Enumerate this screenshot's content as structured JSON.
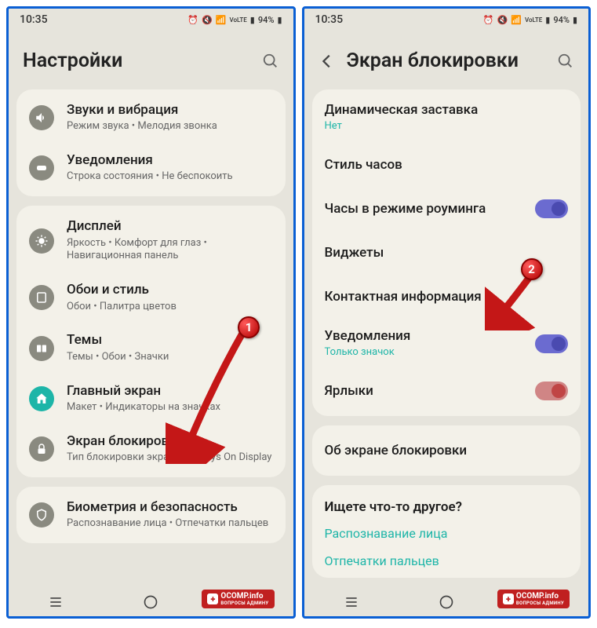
{
  "status": {
    "time": "10:35",
    "battery": "94%"
  },
  "left": {
    "title": "Настройки",
    "groups": [
      [
        {
          "title": "Звуки и вибрация",
          "sub": "Режим звука • Мелодия звонка",
          "icon": "speaker"
        },
        {
          "title": "Уведомления",
          "sub": "Строка состояния • Не беспокоить",
          "icon": "notify"
        }
      ],
      [
        {
          "title": "Дисплей",
          "sub": "Яркость • Комфорт для глаз • Навигационная панель",
          "icon": "display"
        },
        {
          "title": "Обои и стиль",
          "sub": "Обои • Палитра цветов",
          "icon": "wallpaper"
        },
        {
          "title": "Темы",
          "sub": "Темы • Обои • Значки",
          "icon": "themes"
        },
        {
          "title": "Главный экран",
          "sub": "Макет • Индикаторы на значках",
          "icon": "home",
          "iconTeal": true
        },
        {
          "title": "Экран блокировки",
          "sub": "Тип блокировки экрана • Always On Display",
          "icon": "lock"
        }
      ],
      [
        {
          "title": "Биометрия и безопасность",
          "sub": "Распознавание лица • Отпечатки пальцев",
          "icon": "shield"
        }
      ]
    ]
  },
  "right": {
    "title": "Экран блокировки",
    "groups": [
      [
        {
          "title": "Динамическая заставка",
          "subTeal": "Нет"
        },
        {
          "title": "Стиль часов"
        },
        {
          "title": "Часы в режиме роуминга",
          "toggle": "on"
        },
        {
          "title": "Виджеты"
        },
        {
          "title": "Контактная информация"
        },
        {
          "title": "Уведомления",
          "subTeal": "Только значок",
          "toggle": "on"
        },
        {
          "title": "Ярлыки",
          "toggle": "on-red"
        }
      ],
      [
        {
          "title": "Об экране блокировки"
        }
      ]
    ],
    "other": {
      "heading": "Ищете что-то другое?",
      "links": [
        "Распознавание лица",
        "Отпечатки пальцев"
      ]
    }
  },
  "markers": {
    "m1": "1",
    "m2": "2"
  },
  "watermark": {
    "main": "OCOMP.info",
    "sub": "ВОПРОСЫ АДМИНУ"
  }
}
